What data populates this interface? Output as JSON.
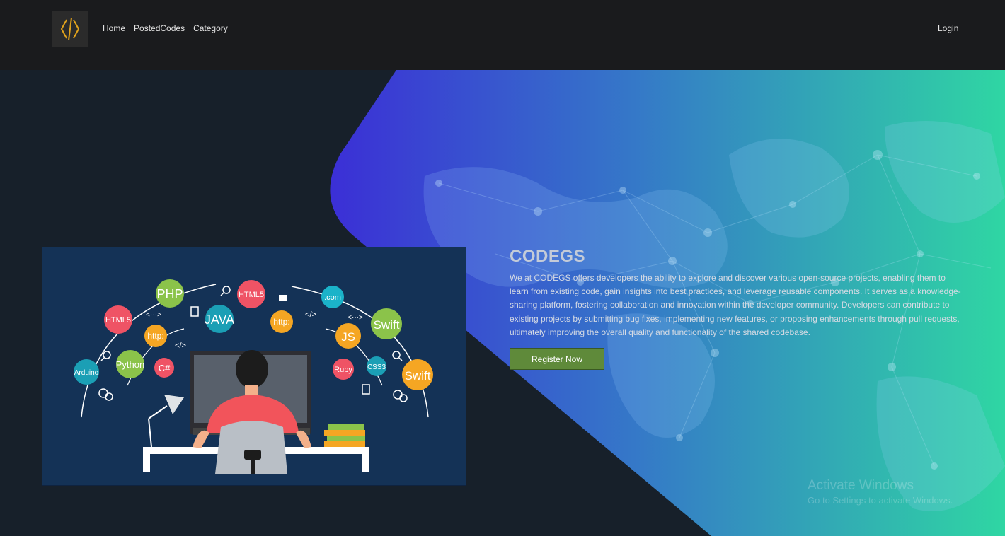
{
  "nav": {
    "logo_icon": "code-brackets-icon",
    "links": [
      "Home",
      "PostedCodes",
      "Category"
    ],
    "login": "Login"
  },
  "hero": {
    "title": "CODEGS",
    "description": "We at CODEGS offers developers the ability to explore and discover various open-source projects, enabling them to learn from existing code, gain insights into best practices, and leverage reusable components. It serves as a knowledge-sharing platform, fostering collaboration and innovation within the developer community. Developers can contribute to existing projects by submitting bug fixes, implementing new features, or proposing enhancements through pull requests, ultimately improving the overall quality and functionality of the shared codebase.",
    "register_button": "Register Now",
    "gradient_start": "#3b2fd6",
    "gradient_end": "#2fd6a3"
  },
  "illustration": {
    "badges": [
      "PHP",
      "HTML5",
      "HTML5",
      ".com",
      "JAVA",
      "Swift",
      "http:",
      "http:",
      "JS",
      "Python",
      "C#",
      "Arduino",
      "Ruby",
      "CSS3",
      "Swift",
      "<···>",
      "</>",
      "</>",
      "<···>"
    ]
  },
  "watermark": {
    "title": "Activate Windows",
    "subtitle": "Go to Settings to activate Windows."
  }
}
